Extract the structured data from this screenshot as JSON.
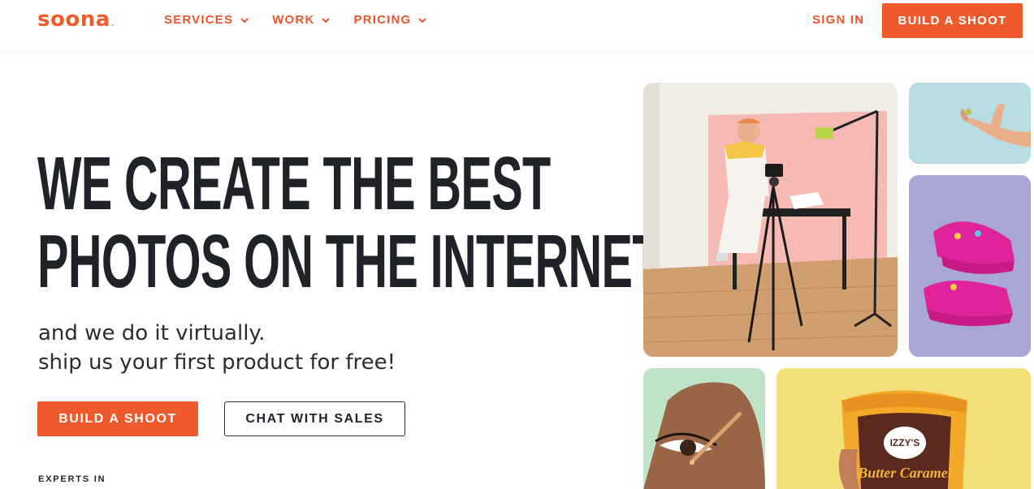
{
  "header": {
    "logo": "soona",
    "logo_mark": ".",
    "nav": [
      {
        "label": "SERVICES",
        "icon": "chevron-down-icon"
      },
      {
        "label": "WORK",
        "icon": "chevron-down-icon"
      },
      {
        "label": "PRICING",
        "icon": "chevron-down-icon"
      }
    ],
    "sign_in": "SIGN IN",
    "cta": "BUILD A SHOOT"
  },
  "hero": {
    "headline_line1": "WE CREATE THE BEST",
    "headline_line2": "PHOTOS ON THE INTERNET",
    "sub_line1": "and we do it virtually.",
    "sub_line2": "ship us your first product for free!",
    "primary_button": "BUILD A SHOOT",
    "secondary_button": "CHAT WITH SALES",
    "experts_label": "EXPERTS IN"
  },
  "gallery": {
    "tiles": [
      {
        "subject": "photographer-studio-photo",
        "bg": "#efe9e2"
      },
      {
        "subject": "hand-holding-gummy-photo",
        "bg": "#b7dde3"
      },
      {
        "subject": "pink-platform-sandals-photo",
        "bg": "#a7a6d6"
      },
      {
        "subject": "eye-dropper-photo",
        "bg": "#bfe3c6"
      },
      {
        "subject": "ice-cream-pint-photo",
        "bg": "#f3df78",
        "brand_text": "IZZY'S",
        "product_text": "Butter Caramel"
      }
    ]
  },
  "colors": {
    "accent": "#ef5a2c",
    "text": "#1f2228"
  }
}
